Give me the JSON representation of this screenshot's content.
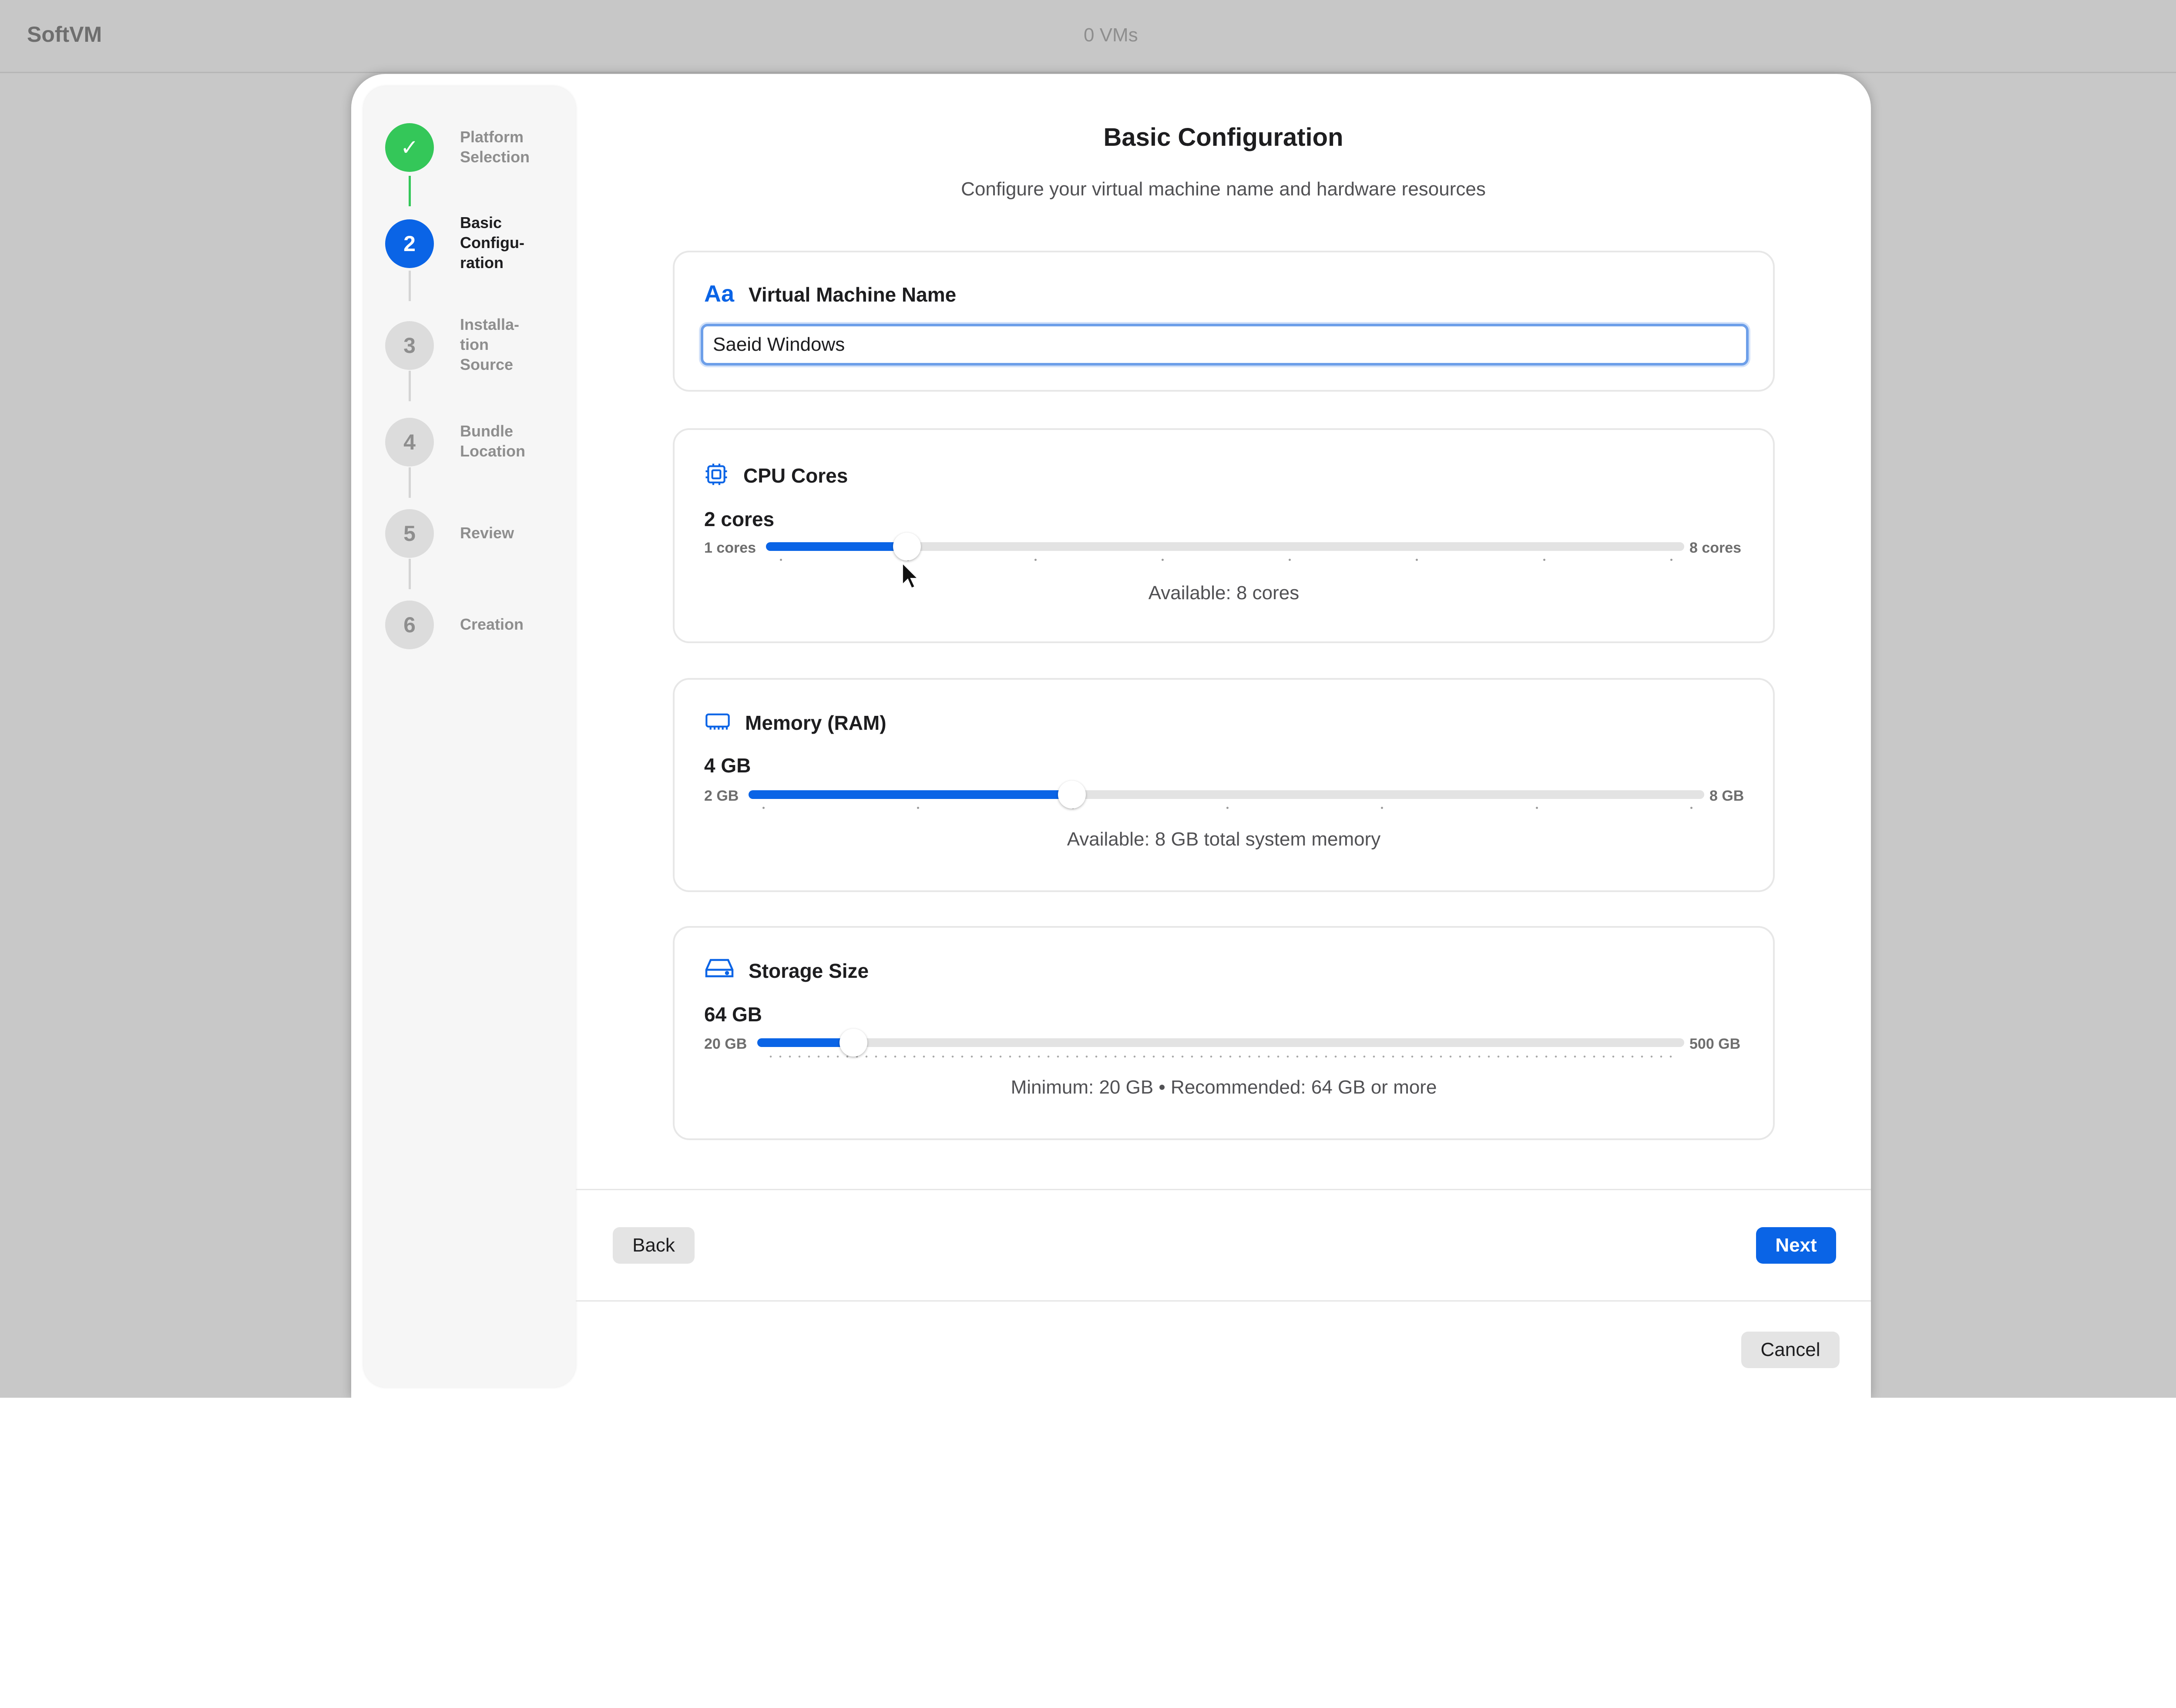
{
  "app": {
    "title": "SoftVM",
    "vm_count": "0 VMs"
  },
  "steps": [
    {
      "number": "✓",
      "label": "Platform\nSelection",
      "state": "done"
    },
    {
      "number": "2",
      "label": "Basic\nConfigu-\nration",
      "state": "active"
    },
    {
      "number": "3",
      "label": "Installa-\ntion\nSource",
      "state": "pending"
    },
    {
      "number": "4",
      "label": "Bundle\nLocation",
      "state": "pending"
    },
    {
      "number": "5",
      "label": "Review",
      "state": "pending"
    },
    {
      "number": "6",
      "label": "Creation",
      "state": "pending"
    }
  ],
  "page": {
    "title": "Basic Configuration",
    "subtitle": "Configure your virtual machine name and hardware resources"
  },
  "vm_name": {
    "icon": "text-aa-icon",
    "icon_text": "Aa",
    "title": "Virtual Machine Name",
    "value": "Saeid Windows"
  },
  "cpu": {
    "icon": "cpu-chip-icon",
    "title": "CPU Cores",
    "value_text": "2 cores",
    "min_label": "1 cores",
    "max_label": "8 cores",
    "min": 1,
    "max": 8,
    "value": 2,
    "note": "Available: 8 cores"
  },
  "memory": {
    "icon": "memory-module-icon",
    "title": "Memory (RAM)",
    "value_text": "4 GB",
    "min_label": "2 GB",
    "max_label": "8 GB",
    "min": 2,
    "max": 8,
    "value": 4,
    "note": "Available: 8 GB total system memory"
  },
  "storage": {
    "icon": "hard-drive-icon",
    "title": "Storage Size",
    "value_text": "64 GB",
    "min_label": "20 GB",
    "max_label": "500 GB",
    "min": 20,
    "max": 500,
    "value": 64,
    "note": "Minimum: 20 GB • Recommended: 64 GB or more"
  },
  "buttons": {
    "back": "Back",
    "next": "Next",
    "cancel": "Cancel"
  },
  "colors": {
    "accent": "#0a64e6",
    "success": "#34c759"
  }
}
